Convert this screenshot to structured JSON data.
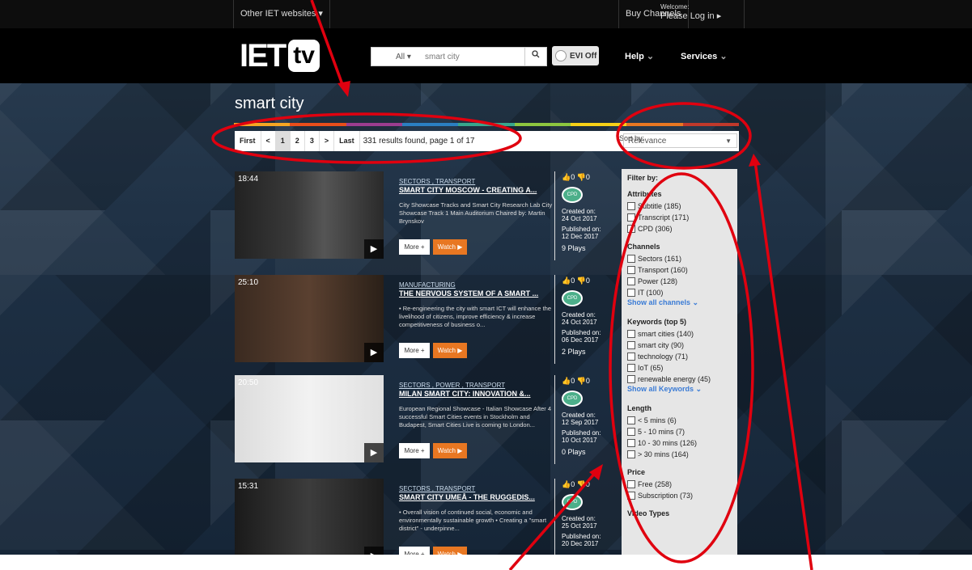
{
  "topbar": {
    "other_sites": "Other IET websites ▾",
    "buy_channels": "Buy Channels",
    "welcome": "Welcome:",
    "login": "Please Log in ▸"
  },
  "logo": {
    "iet": "IET",
    "tv": "tv"
  },
  "search": {
    "scope": "All",
    "value": "smart city"
  },
  "evi": {
    "label": "EVI Off"
  },
  "nav": {
    "help": "Help",
    "services": "Services"
  },
  "page": {
    "title": "smart city"
  },
  "pager": {
    "first": "First",
    "prev": "<",
    "p1": "1",
    "p2": "2",
    "p3": "3",
    "next": ">",
    "last": "Last",
    "info": "331 results found, page 1 of 17"
  },
  "sort": {
    "label": "Sort by:",
    "value": "Relevance"
  },
  "rainbow_colors": [
    "#f5a623",
    "#e94e1b",
    "#9b3d8f",
    "#2b7fc1",
    "#38a58c",
    "#8dc63f",
    "#f7d117",
    "#e87722",
    "#c0392b"
  ],
  "results": [
    {
      "duration": "18:44",
      "cats": "SECTORS , TRANSPORT",
      "title": "SMART CITY MOSCOW - CREATING A...",
      "desc": "City Showcase Tracks and Smart City Research Lab City Showcase Track 1 Main Auditorium Chaired by: Martin Brynskov",
      "likes": "👍0 👎0",
      "created_label": "Created on:",
      "created": "24 Oct 2017",
      "published_label": "Published on:",
      "published": "12 Dec 2017",
      "plays": "9 Plays",
      "more": "More +",
      "watch": "Watch ▶",
      "cpd": "CPD"
    },
    {
      "duration": "25:10",
      "cats": "MANUFACTURING",
      "title": "THE NERVOUS SYSTEM OF A SMART ...",
      "desc": "• Re-engineering the city with smart ICT will enhance the livelihood of citizens, improve efficiency & increase competitiveness of business o...",
      "likes": "👍0 👎0",
      "created_label": "Created on:",
      "created": "24 Oct 2017",
      "published_label": "Published on:",
      "published": "06 Dec 2017",
      "plays": "2 Plays",
      "more": "More +",
      "watch": "Watch ▶",
      "cpd": "CPD"
    },
    {
      "duration": "20:50",
      "cats": "SECTORS , POWER , TRANSPORT",
      "title": "MILAN SMART CITY: INNOVATION &...",
      "desc": "European Regional Showcase - Italian Showcase After 4 successful Smart Cities events in Stockholm and Budapest, Smart Cities Live is coming to London...",
      "likes": "👍0 👎0",
      "created_label": "Created on:",
      "created": "12 Sep 2017",
      "published_label": "Published on:",
      "published": "10 Oct 2017",
      "plays": "0 Plays",
      "more": "More +",
      "watch": "Watch ▶",
      "cpd": "CPD"
    },
    {
      "duration": "15:31",
      "cats": "SECTORS , TRANSPORT",
      "title": "SMART CITY UMEÅ - THE RUGGEDIS...",
      "desc": "• Overall vision of continued social, economic and environmentally sustainable growth • Creating a \"smart district\" - underpinne...",
      "likes": "👍0 👎0",
      "created_label": "Created on:",
      "created": "25 Oct 2017",
      "published_label": "Published on:",
      "published": "20 Dec 2017",
      "plays": "",
      "more": "More +",
      "watch": "Watch ▶",
      "cpd": "CPD"
    }
  ],
  "filter": {
    "heading": "Filter by:",
    "attributes": {
      "title": "Attributes",
      "items": [
        "Subtitle (185)",
        "Transcript (171)",
        "CPD (306)"
      ]
    },
    "channels": {
      "title": "Channels",
      "items": [
        "Sectors (161)",
        "Transport (160)",
        "Power (128)",
        "IT (100)"
      ],
      "show": "Show all channels ⌄"
    },
    "keywords": {
      "title": "Keywords (top 5)",
      "items": [
        "smart cities (140)",
        "smart city (90)",
        "technology (71)",
        "IoT (65)",
        "renewable energy (45)"
      ],
      "show": "Show all Keywords ⌄"
    },
    "length": {
      "title": "Length",
      "items": [
        "< 5 mins (6)",
        "5 - 10 mins (7)",
        "10 - 30 mins (126)",
        "> 30 mins (164)"
      ]
    },
    "price": {
      "title": "Price",
      "items": [
        "Free (258)",
        "Subscription (73)"
      ]
    },
    "video_types": {
      "title": "Video Types"
    }
  }
}
